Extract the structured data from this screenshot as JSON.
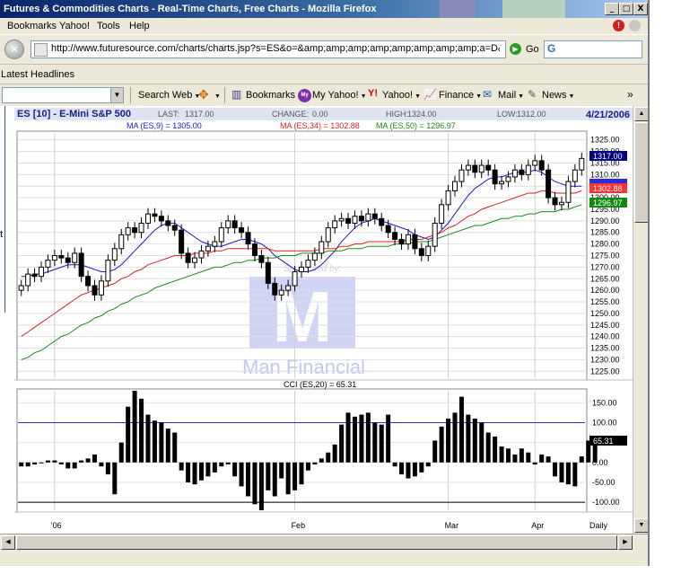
{
  "window": {
    "title": "Futures & Commodities Charts - Real-Time Charts, Free Charts - Mozilla Firefox",
    "minimize": "_",
    "maximize": "□",
    "close": "X"
  },
  "menu": {
    "items": [
      "Bookmarks",
      "Yahoo!",
      "Tools",
      "Help"
    ]
  },
  "nav": {
    "url": "http://www.futuresource.com/charts/charts.jsp?s=ES&o=&amp;amp;amp;amp;amp;amp;amp;amp;a=D&",
    "go_label": "Go",
    "search_value": ""
  },
  "bookmarks_bar": {
    "latest_headlines": "Latest Headlines"
  },
  "yahoo_toolbar": {
    "search_web": "Search Web",
    "bookmarks": "Bookmarks",
    "my_yahoo": "My Yahoo!",
    "yahoo": "Yahoo!",
    "finance": "Finance",
    "mail": "Mail",
    "news": "News",
    "more": "»",
    "my_icon": "My",
    "yahoo_icon": "Y!"
  },
  "sidebar_fragment": "t",
  "chart": {
    "symbol_title": "ES [10] - E-Mini S&P 500",
    "last_label": "LAST:",
    "last_value": "1317.00",
    "change_label": "CHANGE:",
    "change_value": "0.00",
    "high_label": "HIGH:",
    "high_value": "1324.00",
    "low_label": "LOW:",
    "low_value": "1312.00",
    "date": "4/21/2006",
    "ma9_text": "MA (ES,9) = 1305.00",
    "ma34_text": "MA (ES,34) = 1302.88",
    "ma50_text": "MA (ES,50) = 1296.97",
    "last_badge": "1317.00",
    "ma34_badge": "1302.88",
    "ma50_badge": "1296.97",
    "cci_title": "CCI (ES,20) = 65.31",
    "cci_badge": "65.31",
    "sponsor_text": "Sponsored by:",
    "sponsor_name": "Man Financial",
    "sponsor_letter": "M",
    "period": "Daily",
    "colors": {
      "ma9": "#1a1acc",
      "ma34": "#dd2020",
      "ma50": "#1a8a1a",
      "price": "#000000",
      "cci": "#000000",
      "badge_last": "#000080",
      "badge_ma34": "#ff3030",
      "badge_ma50": "#118811"
    }
  },
  "chart_data": [
    {
      "type": "candlestick",
      "title": "ES [10] - E-Mini S&P 500",
      "x_labels": [
        "'06",
        "Feb",
        "Mar",
        "Apr"
      ],
      "y_ticks": [
        "1325.00",
        "1320.00",
        "1315.00",
        "1310.00",
        "1305.00",
        "1300.00",
        "1295.00",
        "1290.00",
        "1285.00",
        "1280.00",
        "1275.00",
        "1270.00",
        "1265.00",
        "1260.00",
        "1255.00",
        "1250.00",
        "1245.00",
        "1240.00",
        "1235.00",
        "1230.00",
        "1225.00"
      ],
      "ylim": [
        1222,
        1328
      ],
      "close": [
        1262,
        1267,
        1266,
        1270,
        1273,
        1275,
        1274,
        1272,
        1276,
        1266,
        1262,
        1258,
        1264,
        1273,
        1278,
        1284,
        1287,
        1285,
        1289,
        1293,
        1292,
        1290,
        1288,
        1286,
        1276,
        1272,
        1274,
        1277,
        1279,
        1281,
        1287,
        1290,
        1287,
        1285,
        1280,
        1275,
        1272,
        1263,
        1258,
        1260,
        1262,
        1268,
        1270,
        1273,
        1276,
        1281,
        1287,
        1290,
        1291,
        1289,
        1292,
        1290,
        1293,
        1291,
        1288,
        1285,
        1282,
        1280,
        1284,
        1278,
        1275,
        1279,
        1289,
        1297,
        1303,
        1307,
        1312,
        1314,
        1311,
        1314,
        1312,
        1306,
        1307,
        1309,
        1312,
        1310,
        1314,
        1316,
        1312,
        1300,
        1297,
        1298,
        1307,
        1312,
        1317
      ],
      "ma_series": [
        {
          "name": "MA (ES,9)",
          "values": [
            1266,
            1266,
            1267,
            1267,
            1268,
            1269,
            1270,
            1271,
            1271,
            1271,
            1270,
            1269,
            1268,
            1268,
            1269,
            1271,
            1274,
            1277,
            1280,
            1283,
            1286,
            1288,
            1289,
            1289,
            1287,
            1285,
            1283,
            1281,
            1280,
            1279,
            1279,
            1280,
            1281,
            1282,
            1282,
            1281,
            1280,
            1278,
            1275,
            1273,
            1271,
            1269,
            1268,
            1268,
            1269,
            1271,
            1274,
            1277,
            1281,
            1284,
            1287,
            1289,
            1290,
            1291,
            1290,
            1289,
            1288,
            1287,
            1286,
            1284,
            1283,
            1282,
            1283,
            1286,
            1289,
            1293,
            1297,
            1301,
            1304,
            1306,
            1308,
            1309,
            1309,
            1310,
            1311,
            1311,
            1311,
            1312,
            1311,
            1309,
            1307,
            1306,
            1305,
            1305,
            1305
          ]
        },
        {
          "name": "MA (ES,34)",
          "values": [
            1240,
            1242,
            1244,
            1246,
            1248,
            1250,
            1252,
            1254,
            1256,
            1258,
            1259,
            1260,
            1261,
            1262,
            1263,
            1265,
            1266,
            1268,
            1269,
            1271,
            1272,
            1273,
            1274,
            1275,
            1275,
            1275,
            1276,
            1276,
            1276,
            1277,
            1277,
            1278,
            1278,
            1278,
            1278,
            1278,
            1278,
            1278,
            1277,
            1277,
            1277,
            1277,
            1277,
            1277,
            1277,
            1278,
            1278,
            1278,
            1279,
            1279,
            1280,
            1280,
            1281,
            1281,
            1281,
            1281,
            1281,
            1281,
            1282,
            1282,
            1282,
            1283,
            1284,
            1285,
            1287,
            1288,
            1290,
            1292,
            1293,
            1295,
            1296,
            1297,
            1298,
            1299,
            1300,
            1301,
            1302,
            1302,
            1303,
            1303,
            1302,
            1302,
            1302,
            1302,
            1303
          ]
        },
        {
          "name": "MA (ES,50)",
          "values": [
            1230,
            1231,
            1233,
            1234,
            1236,
            1238,
            1240,
            1241,
            1243,
            1245,
            1246,
            1248,
            1249,
            1251,
            1252,
            1254,
            1255,
            1257,
            1258,
            1259,
            1261,
            1262,
            1263,
            1264,
            1265,
            1266,
            1267,
            1268,
            1269,
            1270,
            1270,
            1271,
            1272,
            1272,
            1273,
            1273,
            1274,
            1274,
            1274,
            1275,
            1275,
            1275,
            1276,
            1276,
            1276,
            1276,
            1277,
            1277,
            1277,
            1278,
            1278,
            1278,
            1279,
            1279,
            1279,
            1279,
            1280,
            1280,
            1280,
            1281,
            1281,
            1281,
            1282,
            1283,
            1284,
            1285,
            1286,
            1287,
            1288,
            1288,
            1289,
            1290,
            1291,
            1291,
            1292,
            1292,
            1293,
            1293,
            1294,
            1294,
            1294,
            1295,
            1295,
            1296,
            1297
          ]
        }
      ]
    },
    {
      "type": "bar",
      "title": "CCI (ES,20) = 65.31",
      "y_ticks": [
        "150.00",
        "100.00",
        "50.00",
        "0.00",
        "-50.00",
        "-100.00"
      ],
      "ylim": [
        -120,
        180
      ],
      "reference_lines": [
        100,
        -100
      ],
      "values": [
        -10,
        -10,
        -5,
        0,
        5,
        5,
        -5,
        -15,
        -15,
        5,
        10,
        20,
        -10,
        -30,
        -80,
        50,
        140,
        180,
        160,
        120,
        105,
        100,
        85,
        75,
        -20,
        -50,
        -55,
        -45,
        -35,
        -25,
        -10,
        -5,
        -35,
        -60,
        -85,
        -105,
        -120,
        -70,
        -85,
        -40,
        -80,
        -70,
        -55,
        -20,
        -5,
        10,
        25,
        45,
        95,
        125,
        115,
        120,
        125,
        100,
        95,
        120,
        -10,
        -30,
        -40,
        -35,
        -25,
        -10,
        55,
        90,
        110,
        125,
        165,
        120,
        110,
        100,
        75,
        65,
        40,
        35,
        20,
        35,
        25,
        -5,
        20,
        15,
        -35,
        -50,
        -55,
        -60,
        15,
        55,
        65
      ]
    }
  ]
}
